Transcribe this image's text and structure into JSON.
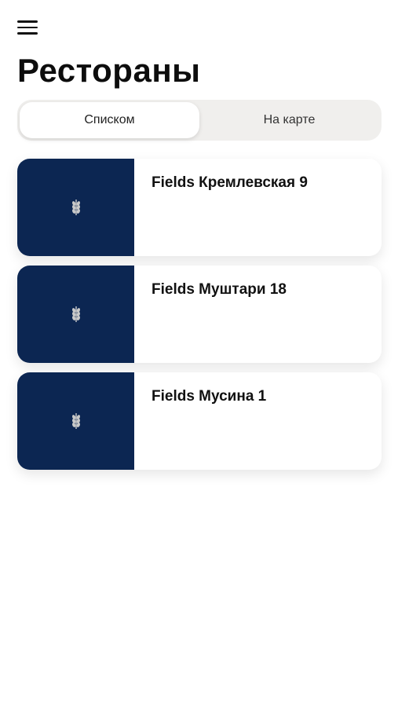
{
  "header": {
    "menu_icon": "hamburger-menu-icon",
    "title": "Рестораны"
  },
  "view_toggle": {
    "options": [
      {
        "label": "Списком",
        "active": true
      },
      {
        "label": "На карте",
        "active": false
      }
    ]
  },
  "restaurants": [
    {
      "name": "Fields Кремлевская 9",
      "logo_icon": "wheat-logo-icon"
    },
    {
      "name": "Fields Муштари 18",
      "logo_icon": "wheat-logo-icon"
    },
    {
      "name": "Fields Мусина 1",
      "logo_icon": "wheat-logo-icon"
    }
  ],
  "colors": {
    "thumb_background": "#0c2652",
    "toggle_background": "#f0efed"
  }
}
